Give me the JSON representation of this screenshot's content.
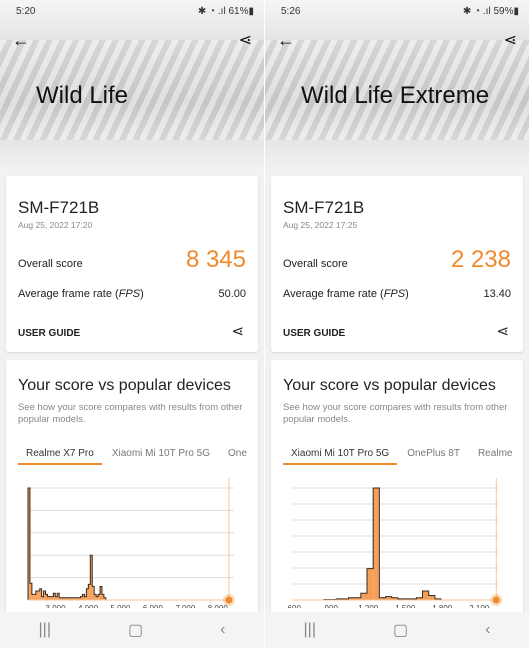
{
  "accent": "#f08a2c",
  "panels": [
    {
      "status": {
        "time": "5:20",
        "battery": "61%"
      },
      "title": "Wild Life",
      "device": "SM-F721B",
      "date": "Aug 25, 2022 17:20",
      "overall_label": "Overall score",
      "score": "8 345",
      "fps_label": "Average frame rate (FPS)",
      "fps": "50.00",
      "guide": "USER GUIDE",
      "compare_title": "Your score vs popular devices",
      "compare_sub": "See how your score compares with results from other popular models.",
      "tabs": [
        "Realme X7 Pro",
        "Xiaomi Mi 10T Pro 5G",
        "One"
      ],
      "chart_data": {
        "type": "bar",
        "xlim": [
          2150,
          8500
        ],
        "ticks": [
          "3 000",
          "4 000",
          "5 000",
          "6 000",
          "7 000",
          "8 000"
        ],
        "tick_values": [
          3000,
          4000,
          5000,
          6000,
          7000,
          8000
        ],
        "bin_start": 2150,
        "bin_width": 60,
        "values": [
          100,
          15,
          5,
          5,
          8,
          8,
          10,
          3,
          8,
          5,
          3,
          3,
          3,
          6,
          3,
          6,
          2,
          2,
          2,
          2,
          2,
          2,
          2,
          2,
          2,
          2,
          2,
          3,
          5,
          3,
          10,
          14,
          40,
          12,
          5,
          3,
          5,
          12,
          5,
          2,
          0
        ],
        "marker": 8345,
        "grid_lines": 5
      }
    },
    {
      "status": {
        "time": "5:26",
        "battery": "59%"
      },
      "title": "Wild Life Extreme",
      "device": "SM-F721B",
      "date": "Aug 25, 2022 17:25",
      "overall_label": "Overall score",
      "score": "2 238",
      "fps_label": "Average frame rate (FPS)",
      "fps": "13.40",
      "guide": "USER GUIDE",
      "compare_title": "Your score vs popular devices",
      "compare_sub": "See how your score compares with results from other popular models.",
      "tabs": [
        "Xiaomi Mi 10T Pro 5G",
        "OnePlus 8T",
        "Realme"
      ],
      "chart_data": {
        "type": "bar",
        "xlim": [
          590,
          2260
        ],
        "ticks": [
          "600",
          "900",
          "1 200",
          "1 500",
          "1 800",
          "2 100"
        ],
        "tick_values": [
          600,
          900,
          1200,
          1500,
          1800,
          2100
        ],
        "bin_start": 590,
        "bin_width": 50,
        "values": [
          0,
          0,
          0,
          0,
          0,
          0.5,
          0.5,
          1,
          1,
          2,
          2,
          6,
          28,
          100,
          2,
          3,
          2,
          1,
          1,
          1,
          2,
          8,
          4,
          1,
          0
        ],
        "marker": 2238,
        "grid_lines": 7
      }
    }
  ]
}
